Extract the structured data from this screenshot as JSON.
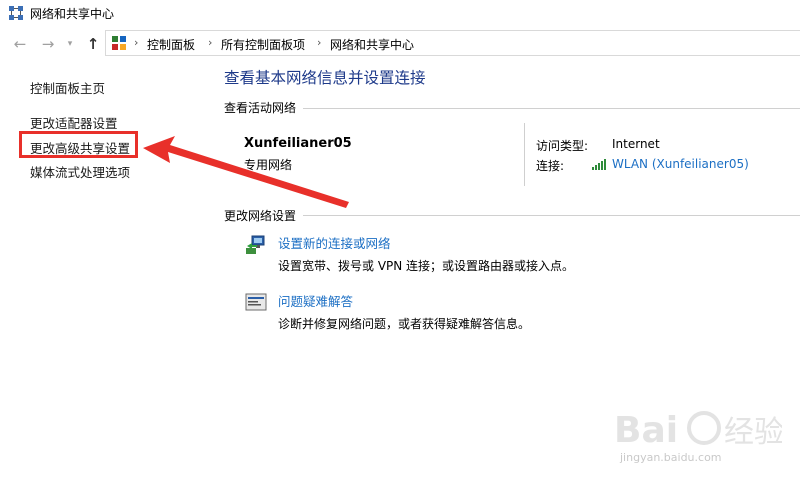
{
  "window": {
    "title": "网络和共享中心"
  },
  "address_bar": {
    "breadcrumbs": [
      "控制面板",
      "所有控制面板项",
      "网络和共享中心"
    ]
  },
  "left_pane": {
    "items": [
      {
        "label": "控制面板主页"
      },
      {
        "label": "更改适配器设置"
      },
      {
        "label": "更改高级共享设置"
      },
      {
        "label": "媒体流式处理选项"
      }
    ]
  },
  "main": {
    "title": "查看基本网络信息并设置连接",
    "active_networks": {
      "section_label": "查看活动网络",
      "network_name": "Xunfeilianer05",
      "network_type": "专用网络",
      "access_type_label": "访问类型:",
      "access_type_value": "Internet",
      "connection_label": "连接:",
      "connection_value": "WLAN (Xunfeilianer05)"
    },
    "change_settings": {
      "section_label": "更改网络设置",
      "tasks": [
        {
          "link": "设置新的连接或网络",
          "description": "设置宽带、拨号或 VPN 连接；或设置路由器或接入点。",
          "icon": "network-setup-icon"
        },
        {
          "link": "问题疑难解答",
          "description": "诊断并修复网络问题，或者获得疑难解答信息。",
          "icon": "troubleshoot-icon"
        }
      ]
    }
  },
  "watermark": {
    "text": "jingyan.baidu.com"
  },
  "colors": {
    "accent_link": "#1c6fc4",
    "highlight": "#e8302a",
    "title_blue": "#1e3a8a"
  }
}
